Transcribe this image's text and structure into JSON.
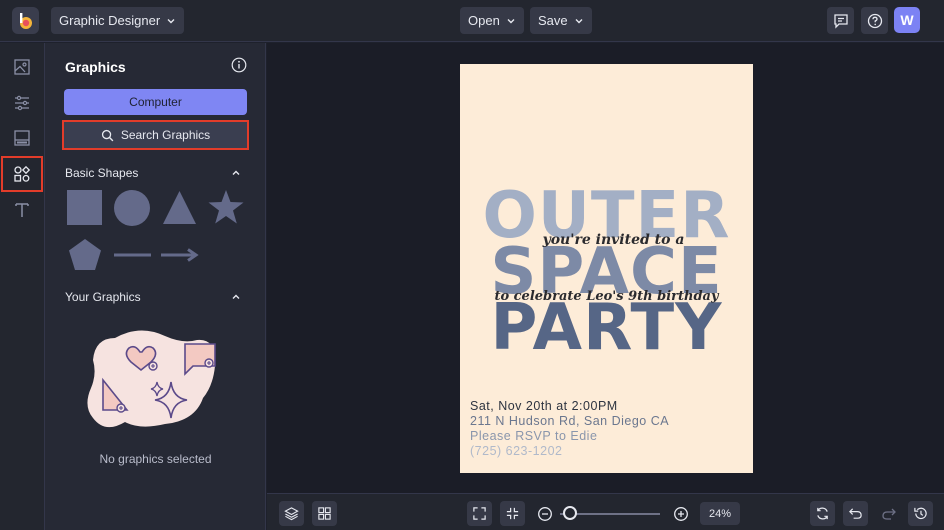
{
  "topbar": {
    "app_menu_label": "Graphic Designer",
    "open_label": "Open",
    "save_label": "Save",
    "avatar_initial": "W"
  },
  "rail": {
    "items": [
      "image-icon",
      "sliders-icon",
      "layout-icon",
      "shapes-icon",
      "text-icon"
    ]
  },
  "panel": {
    "title": "Graphics",
    "computer_button": "Computer",
    "search_button": "Search Graphics",
    "basic_shapes_header": "Basic Shapes",
    "your_graphics_header": "Your Graphics",
    "empty_text": "No graphics selected"
  },
  "design": {
    "headline_1": "OUTER",
    "headline_2": "SPACE",
    "headline_3": "PARTY",
    "script_1": "you're invited to a",
    "script_2": "to celebrate Leo's 9th birthday",
    "detail_1": "Sat, Nov 20th at 2:00PM",
    "detail_2": "211 N Hudson Rd, San Diego CA",
    "detail_3": "Please RSVP to Edie",
    "detail_4": "(725) 623-1202"
  },
  "bottombar": {
    "zoom_value": "24%"
  },
  "colors": {
    "accent": "#7f86f3",
    "highlight": "#e23c2a",
    "page_bg": "#fdecd8"
  }
}
